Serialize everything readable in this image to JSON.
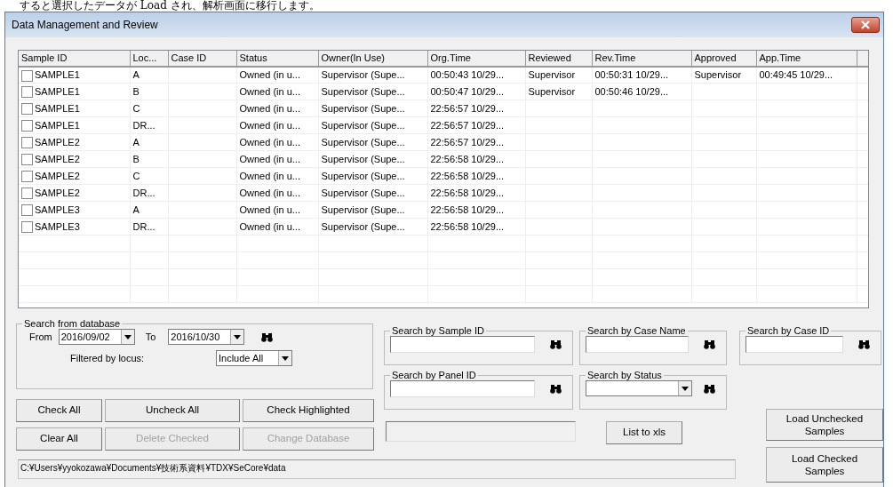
{
  "page_caption": "すると選択したデータが Load され、解析画面に移行します。",
  "window": {
    "title": "Data Management and Review"
  },
  "table": {
    "columns": [
      "Sample ID",
      "Loc...",
      "Case ID",
      "Status",
      "Owner(In Use)",
      "Org.Time",
      "Reviewed",
      "Rev.Time",
      "Approved",
      "App.Time"
    ],
    "rows": [
      {
        "checked": false,
        "cells": [
          "SAMPLE1",
          "A",
          "",
          "Owned (in u...",
          "Supervisor (Supe...",
          "00:50:43 10/29...",
          "Supervisor",
          "00:50:31 10/29...",
          "Supervisor",
          "00:49:45 10/29..."
        ]
      },
      {
        "checked": false,
        "cells": [
          "SAMPLE1",
          "B",
          "",
          "Owned (in u...",
          "Supervisor (Supe...",
          "00:50:47 10/29...",
          "Supervisor",
          "00:50:46 10/29...",
          "",
          ""
        ]
      },
      {
        "checked": false,
        "cells": [
          "SAMPLE1",
          "C",
          "",
          "Owned (in u...",
          "Supervisor (Supe...",
          "22:56:57 10/29...",
          "",
          "",
          "",
          ""
        ]
      },
      {
        "checked": false,
        "cells": [
          "SAMPLE1",
          "DR...",
          "",
          "Owned (in u...",
          "Supervisor (Supe...",
          "22:56:57 10/29...",
          "",
          "",
          "",
          ""
        ]
      },
      {
        "checked": false,
        "cells": [
          "SAMPLE2",
          "A",
          "",
          "Owned (in u...",
          "Supervisor (Supe...",
          "22:56:57 10/29...",
          "",
          "",
          "",
          ""
        ]
      },
      {
        "checked": false,
        "cells": [
          "SAMPLE2",
          "B",
          "",
          "Owned (in u...",
          "Supervisor (Supe...",
          "22:56:58 10/29...",
          "",
          "",
          "",
          ""
        ]
      },
      {
        "checked": false,
        "cells": [
          "SAMPLE2",
          "C",
          "",
          "Owned (in u...",
          "Supervisor (Supe...",
          "22:56:58 10/29...",
          "",
          "",
          "",
          ""
        ]
      },
      {
        "checked": false,
        "cells": [
          "SAMPLE2",
          "DR...",
          "",
          "Owned (in u...",
          "Supervisor (Supe...",
          "22:56:58 10/29...",
          "",
          "",
          "",
          ""
        ]
      },
      {
        "checked": false,
        "cells": [
          "SAMPLE3",
          "A",
          "",
          "Owned (in u...",
          "Supervisor (Supe...",
          "22:56:58 10/29...",
          "",
          "",
          "",
          ""
        ]
      },
      {
        "checked": false,
        "cells": [
          "SAMPLE3",
          "DR...",
          "",
          "Owned (in u...",
          "Supervisor (Supe...",
          "22:56:58 10/29...",
          "",
          "",
          "",
          ""
        ]
      }
    ]
  },
  "database_search": {
    "title": "Search from database",
    "from_label": "From",
    "from_value": "2016/09/02",
    "to_label": "To",
    "to_value": "2016/10/30",
    "filter_label": "Filtered by locus:",
    "filter_value": "Include All"
  },
  "action_buttons": [
    {
      "label": "Check All",
      "disabled": false
    },
    {
      "label": "Uncheck All",
      "disabled": false
    },
    {
      "label": "Check Highlighted",
      "disabled": false
    },
    {
      "label": "Clear All",
      "disabled": false
    },
    {
      "label": "Delete Checked",
      "disabled": true
    },
    {
      "label": "Change Database",
      "disabled": true
    }
  ],
  "path": "C:¥Users¥yyokozawa¥Documents¥技術系資料¥TDX¥SeCore¥data",
  "search_boxes": [
    {
      "title": "Search by Sample ID",
      "kind": "text"
    },
    {
      "title": "Search by Case Name",
      "kind": "text"
    },
    {
      "title": "Search by Case ID",
      "kind": "text"
    },
    {
      "title": "Search by Panel ID",
      "kind": "text"
    },
    {
      "title": "Search by Status",
      "kind": "dropdown"
    }
  ],
  "list_button": "List to xls",
  "load_buttons": [
    "Load Unchecked Samples",
    "Load Checked Samples"
  ]
}
